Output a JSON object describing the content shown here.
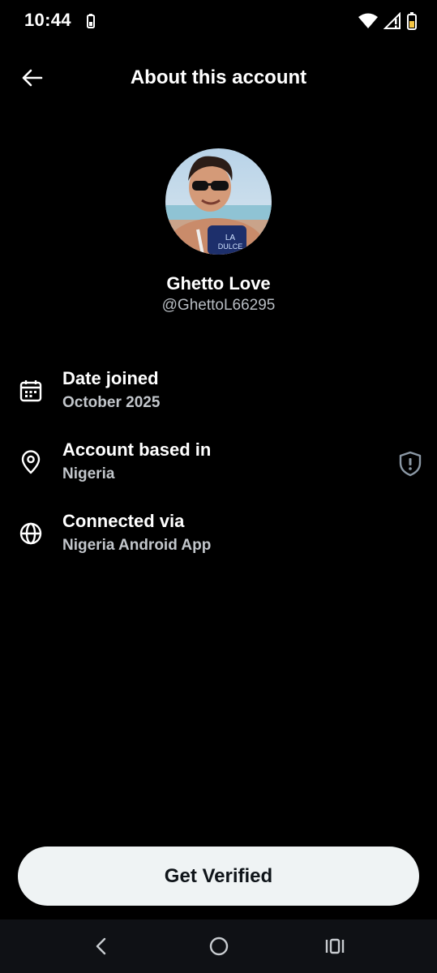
{
  "status_bar": {
    "time": "10:44",
    "icons": [
      "battery-saver-icon",
      "wifi-icon",
      "signal-icon",
      "battery-icon"
    ]
  },
  "header": {
    "title": "About this account",
    "back_icon": "arrow-left-icon"
  },
  "profile": {
    "name": "Ghetto Love",
    "handle": "@GhettoL66295"
  },
  "info": [
    {
      "icon": "calendar-icon",
      "label": "Date joined",
      "value": "October 2025"
    },
    {
      "icon": "location-pin-icon",
      "label": "Account based in",
      "value": "Nigeria",
      "badge_icon": "shield-alert-icon"
    },
    {
      "icon": "globe-icon",
      "label": "Connected via",
      "value": "Nigeria Android App"
    }
  ],
  "cta": {
    "label": "Get Verified"
  },
  "nav_bar": {
    "icons": [
      "nav-back-icon",
      "nav-home-icon",
      "nav-recents-icon"
    ]
  },
  "colors": {
    "background": "#000000",
    "text_primary": "#ffffff",
    "text_secondary": "#b7bcc2",
    "button_bg": "#eff3f4",
    "button_text": "#0f1419"
  }
}
